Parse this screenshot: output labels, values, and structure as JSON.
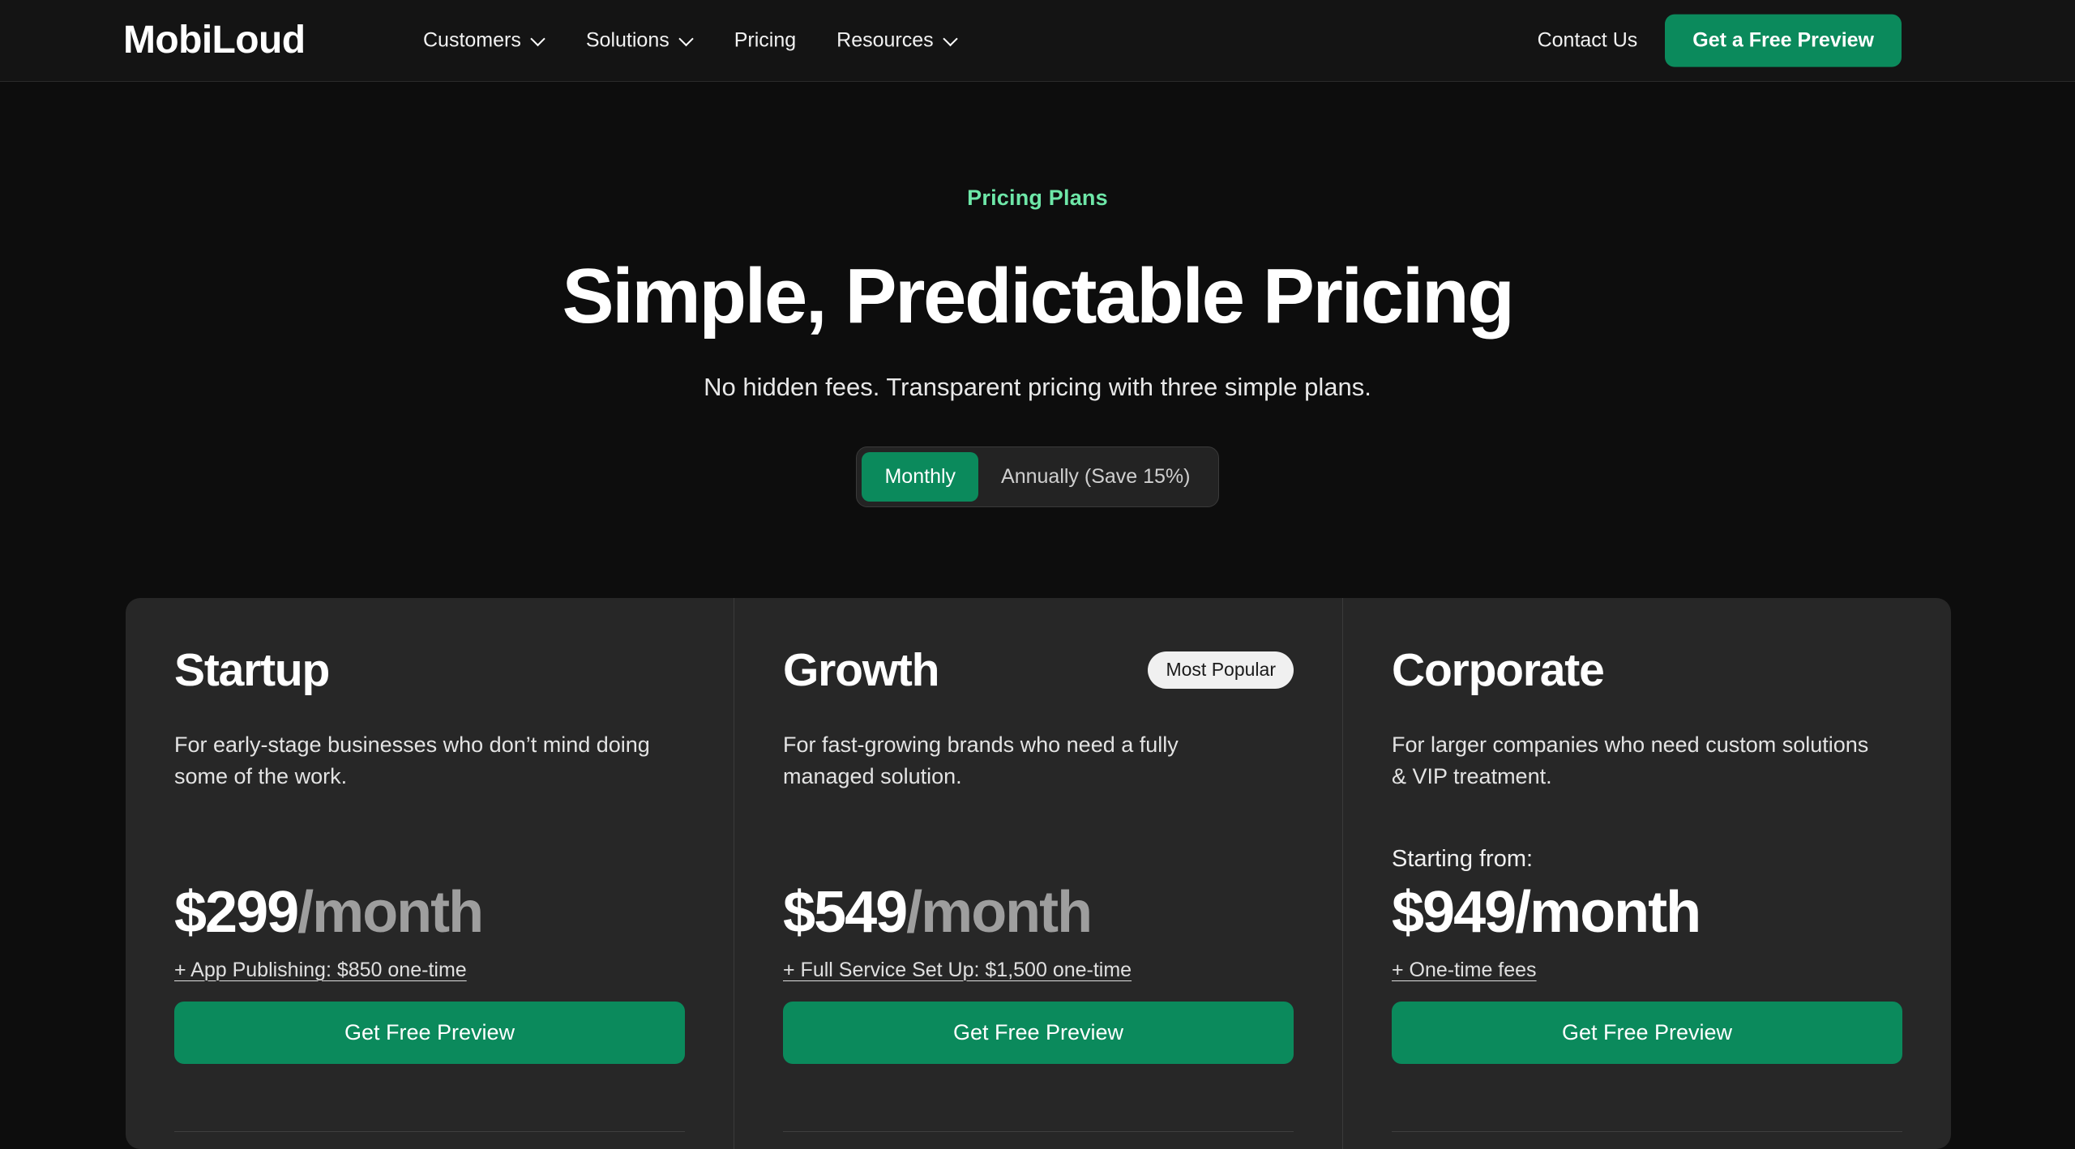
{
  "navbar": {
    "logo": "MobiLoud",
    "links": [
      {
        "label": "Customers",
        "has_caret": true
      },
      {
        "label": "Solutions",
        "has_caret": true
      },
      {
        "label": "Pricing",
        "has_caret": false
      },
      {
        "label": "Resources",
        "has_caret": true
      }
    ],
    "contact_label": "Contact Us",
    "cta_label": "Get a Free Preview"
  },
  "hero": {
    "eyebrow": "Pricing Plans",
    "title": "Simple, Predictable Pricing",
    "subtitle": "No hidden fees. Transparent pricing with three simple plans."
  },
  "billing_toggle": {
    "monthly_label": "Monthly",
    "annual_label": "Annually (Save 15%)",
    "selected": "Monthly"
  },
  "plans": [
    {
      "name": "Startup",
      "badge": null,
      "description": "For early-stage businesses who don’t mind doing some of the work.",
      "starting_from": null,
      "price": "$299",
      "period": "/month",
      "addon": "+ App Publishing: $850 one-time",
      "cta_label": "Get Free Preview"
    },
    {
      "name": "Growth",
      "badge": "Most Popular",
      "description": "For fast-growing brands who need a fully managed solution.",
      "starting_from": null,
      "price": "$549",
      "period": "/month",
      "addon": "+ Full Service Set Up: $1,500 one-time",
      "cta_label": "Get Free Preview"
    },
    {
      "name": "Corporate",
      "badge": null,
      "description": "For larger companies who need custom solutions & VIP treatment.",
      "starting_from": "Starting from:",
      "price": "$949",
      "period": "/month",
      "addon": "+ One-time fees",
      "cta_label": "Get Free Preview"
    }
  ],
  "colors": {
    "page_background": "#0d0d0d",
    "navbar_background": "#141414",
    "card_background": "#272727",
    "accent_green": "#0b8a5c",
    "eyebrow_green": "#6ee7a8",
    "badge_background": "#f0f0f0",
    "muted_text": "#9e9e9e"
  }
}
